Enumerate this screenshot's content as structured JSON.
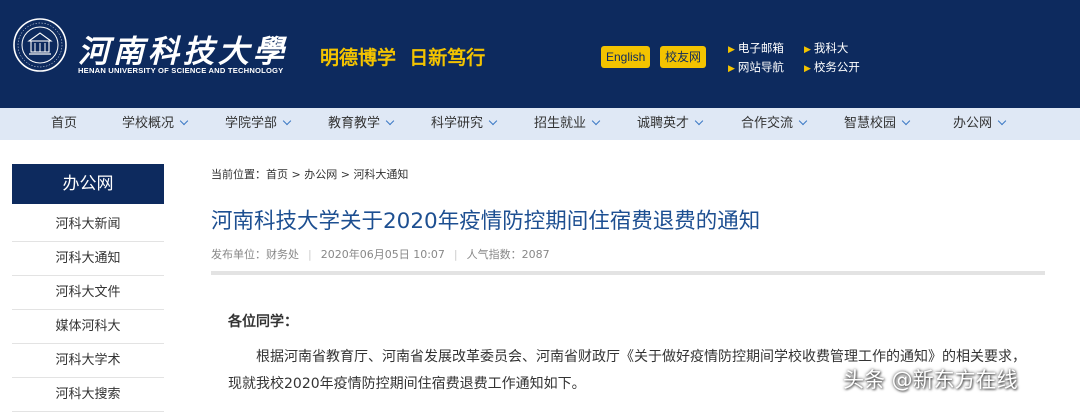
{
  "header": {
    "school_name_cn": "河南科技大學",
    "school_name_en": "HENAN UNIVERSITY OF SCIENCE AND TECHNOLOGY",
    "motto": "明德博学  日新笃行",
    "english_button": "English",
    "alumni_button": "校友网",
    "quick_links": [
      "电子邮箱",
      "我科大",
      "网站导航",
      "校务公开"
    ],
    "colors": {
      "header_bg": "#0d2a5e",
      "accent": "#f3c300"
    }
  },
  "nav": {
    "items": [
      "首页",
      "学校概况",
      "学院学部",
      "教育教学",
      "科学研究",
      "招生就业",
      "诚聘英才",
      "合作交流",
      "智慧校园",
      "办公网"
    ]
  },
  "sidebar": {
    "title": "办公网",
    "items": [
      "河科大新闻",
      "河科大通知",
      "河科大文件",
      "媒体河科大",
      "河科大学术",
      "河科大搜索"
    ]
  },
  "breadcrumb": {
    "prefix": "当前位置：",
    "items": [
      "首页",
      "办公网",
      "河科大通知"
    ],
    "separator": ">"
  },
  "article": {
    "title": "河南科技大学关于2020年疫情防控期间住宿费退费的通知",
    "publisher": "发布单位：财务处",
    "date": "2020年06月05日 10:07",
    "views": "人气指数：2087",
    "greeting": "各位同学：",
    "paragraph": "根据河南省教育厅、河南省发展改革委员会、河南省财政厅《关于做好疫情防控期间学校收费管理工作的通知》的相关要求，现就我校2020年疫情防控期间住宿费退费工作通知如下。"
  },
  "watermark": "头条 @新东方在线"
}
